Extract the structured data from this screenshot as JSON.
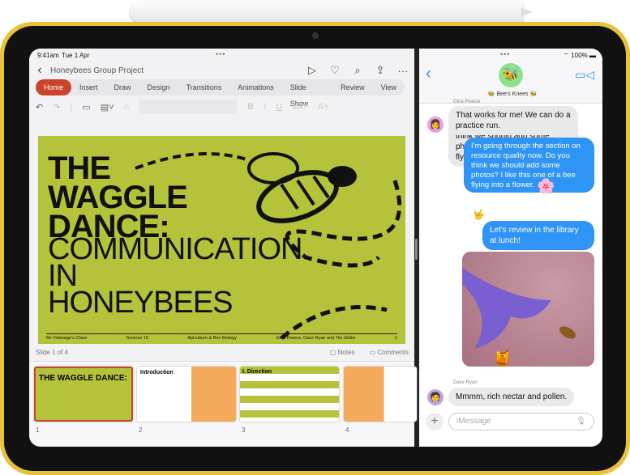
{
  "left_app": {
    "time": "9:41am",
    "date": "Tue 1 Apr",
    "doc_title": "Honeybees Group Project",
    "tabs": [
      "Home",
      "Insert",
      "Draw",
      "Design",
      "Transitions",
      "Animations",
      "Slide Show",
      "Review",
      "View"
    ],
    "active_tab": "Home",
    "slide": {
      "title_bold": [
        "THE",
        "WAGGLE",
        "DANCE:"
      ],
      "title_thin": [
        "COMMUNICATION",
        "IN",
        "HONEYBEES"
      ],
      "footer": [
        "Mr Vidanage's Class",
        "Science 10",
        "Apiculture & Bee Biology",
        "Gina Pearce, Dave Ryan and Tim Gibbs",
        "1"
      ]
    },
    "slide_counter": "Slide 1 of 4",
    "notes": "Notes",
    "comments": "Comments",
    "thumbnails": [
      {
        "num": "1",
        "label": "THE WAGGLE DANCE:"
      },
      {
        "num": "2",
        "label": "Introduction"
      },
      {
        "num": "3",
        "label": "I. Direction"
      },
      {
        "num": "4",
        "label": ""
      }
    ],
    "accent": "#c8442a",
    "slide_color": "#b5c33b"
  },
  "right_app": {
    "battery": "100%",
    "group_name": "🐝 Bee's Knees 🐝",
    "messages": [
      {
        "sender": "Gina Pearce",
        "dir": "in",
        "text": "That works for me! We can do a practice run."
      },
      {
        "dir": "out",
        "text": "I'm going through the section on resource quality now. Do you think we should add some photos? I like this one of a bee flying into a flower.",
        "reaction": "🌸"
      },
      {
        "dir": "out",
        "text": "Let's review in the library at lunch!",
        "tapback": "🤟"
      },
      {
        "dir": "out",
        "type": "photo",
        "sticker": "🍯"
      },
      {
        "sender": "Dave Ryan",
        "dir": "in",
        "text": "Mmmm, rich nectar and pollen."
      }
    ],
    "placeholder": "iMessage",
    "bubble_color": "#2e94f5"
  }
}
